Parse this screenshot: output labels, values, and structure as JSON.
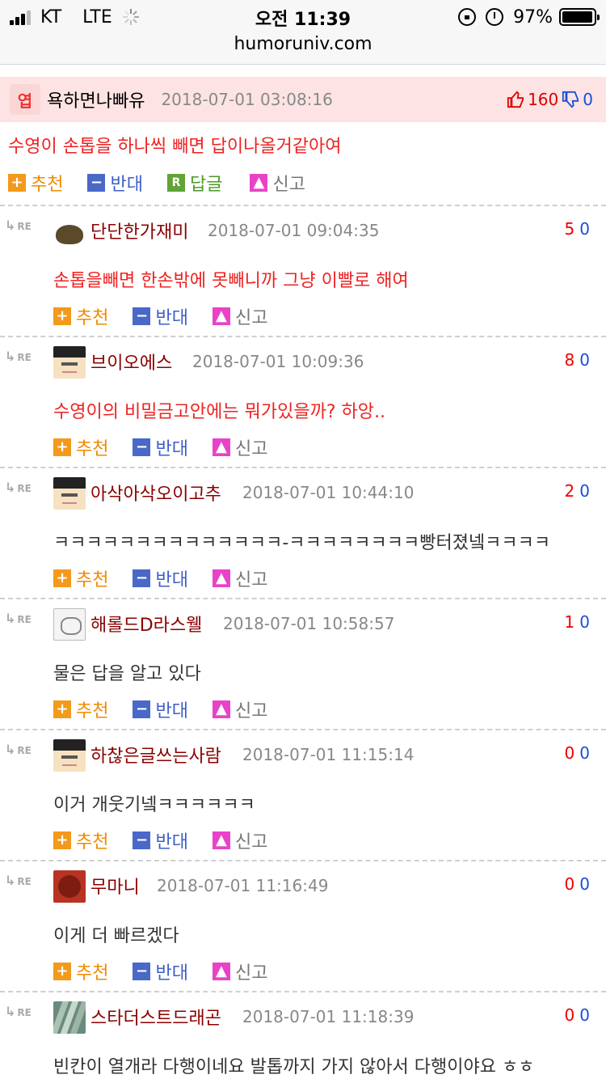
{
  "status_bar": {
    "carrier": "KT",
    "network": "LTE",
    "time": "오전 11:39",
    "battery": "97%",
    "battery_level": 0.97
  },
  "browser": {
    "url": "humoruniv.com"
  },
  "post": {
    "badge": "엽",
    "author": "욕하면나빠유",
    "date": "2018-07-01 03:08:16",
    "upvotes": "160",
    "downvotes": "0",
    "body": "수영이 손톱을 하나씩 빼면 답이나올거같아여",
    "actions": {
      "recommend": "추천",
      "oppose": "반대",
      "reply": "답글",
      "report": "신고"
    }
  },
  "comment_actions": {
    "recommend": "추천",
    "oppose": "반대",
    "report": "신고"
  },
  "comments": [
    {
      "re": "RE",
      "author": "단단한가재미",
      "date": "2018-07-01 09:04:35",
      "up": "5",
      "down": "0",
      "body": "손톱을빼면 한손밖에 못빼니까 그냥 이빨로 해여",
      "body_color": "red",
      "avatar": "rock"
    },
    {
      "re": "RE",
      "author": "브이오에스",
      "date": "2018-07-01 10:09:36",
      "up": "8",
      "down": "0",
      "body": "수영이의 비밀금고안에는 뭐가있을까? 하앙..",
      "body_color": "red",
      "avatar": "pixel"
    },
    {
      "re": "RE",
      "author": "아삭아삭오이고추",
      "date": "2018-07-01 10:44:10",
      "up": "2",
      "down": "0",
      "body": "ㅋㅋㅋㅋㅋㅋㅋㅋㅋㅋㅋㅋㅋㅋ-ㅋㅋㅋㅋㅋㅋㅋㅋ빵터졌넼ㅋㅋㅋㅋ",
      "body_color": "dark",
      "avatar": "pixel"
    },
    {
      "re": "RE",
      "author": "해롤드D라스웰",
      "date": "2018-07-01 10:58:57",
      "up": "1",
      "down": "0",
      "body": "물은 답을 알고 있다",
      "body_color": "dark",
      "avatar": "cat"
    },
    {
      "re": "RE",
      "author": "하찮은글쓰는사람",
      "date": "2018-07-01 11:15:14",
      "up": "0",
      "down": "0",
      "body": "이거 개웃기넼ㅋㅋㅋㅋㅋㅋ",
      "body_color": "dark",
      "avatar": "pixel"
    },
    {
      "re": "RE",
      "author": "무마니",
      "date": "2018-07-01 11:16:49",
      "up": "0",
      "down": "0",
      "body": "이게 더 빠르겠다",
      "body_color": "dark",
      "avatar": "food"
    },
    {
      "re": "RE",
      "author": "스타더스트드래곤",
      "date": "2018-07-01 11:18:39",
      "up": "0",
      "down": "0",
      "body": "빈칸이 열개라 다행이네요 발톱까지 가지 않아서 다행이야요 ㅎㅎ",
      "body_color": "dark",
      "avatar": "plant"
    }
  ]
}
